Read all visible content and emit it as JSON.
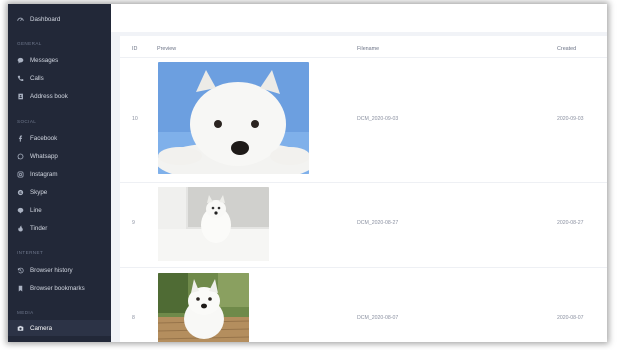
{
  "sidebar": {
    "dashboard": "Dashboard",
    "sections": {
      "general": "GENERAL",
      "social": "SOCIAL",
      "internet": "INTERNET",
      "media": "MEDIA"
    },
    "general_items": [
      {
        "label": "Messages",
        "icon": "chat-bubble-icon"
      },
      {
        "label": "Calls",
        "icon": "phone-icon"
      },
      {
        "label": "Address book",
        "icon": "address-book-icon"
      }
    ],
    "social_items": [
      {
        "label": "Facebook",
        "icon": "facebook-icon"
      },
      {
        "label": "Whatsapp",
        "icon": "whatsapp-icon"
      },
      {
        "label": "Instagram",
        "icon": "instagram-icon"
      },
      {
        "label": "Skype",
        "icon": "skype-icon"
      },
      {
        "label": "Line",
        "icon": "line-icon"
      },
      {
        "label": "Tinder",
        "icon": "tinder-icon"
      }
    ],
    "internet_items": [
      {
        "label": "Browser history",
        "icon": "history-icon"
      },
      {
        "label": "Browser bookmarks",
        "icon": "bookmark-icon"
      }
    ],
    "media_items": [
      {
        "label": "Camera",
        "icon": "camera-icon",
        "active": true
      }
    ]
  },
  "table": {
    "headers": {
      "id": "ID",
      "preview": "Preview",
      "filename": "Filename",
      "created": "Created"
    },
    "rows": [
      {
        "id": "10",
        "filename": "DCM_2020-09-03",
        "created": "2020-09-03",
        "preview": "westie dog lying on blue background"
      },
      {
        "id": "9",
        "filename": "DCM_2020-08-27",
        "created": "2020-08-27",
        "preview": "westie dog sitting on white blanket"
      },
      {
        "id": "8",
        "filename": "DCM_2020-08-07",
        "created": "2020-08-07",
        "preview": "westie dog on wooden deck outdoors"
      }
    ]
  },
  "colors": {
    "sidebar_bg": "#222838",
    "accent": "#2c3346",
    "page_bg": "#f1f3f7"
  }
}
